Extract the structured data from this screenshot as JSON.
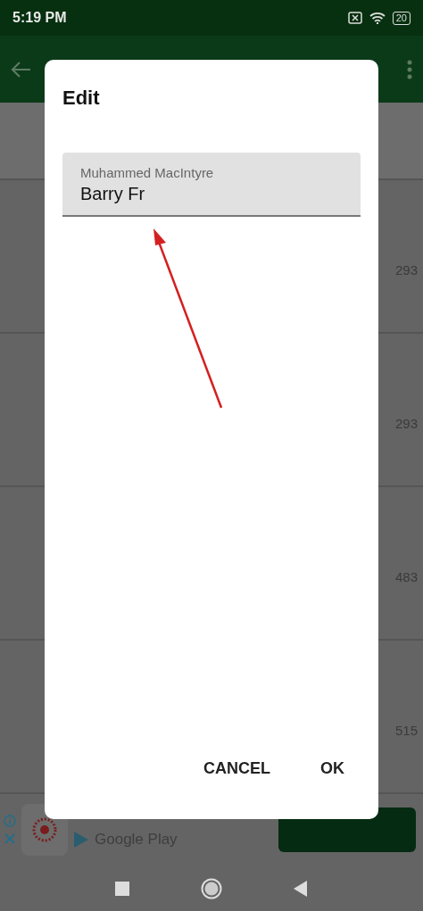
{
  "status_bar": {
    "time": "5:19 PM",
    "battery": "20"
  },
  "list": {
    "rows": [
      {
        "value": "293"
      },
      {
        "value": "293"
      },
      {
        "value": "483"
      },
      {
        "value": "515"
      }
    ]
  },
  "ad_banner": {
    "text": "Google Play"
  },
  "dialog": {
    "title": "Edit",
    "field": {
      "label": "Muhammed MacIntyre",
      "value": "Barry Fr"
    },
    "buttons": [
      "CANCEL",
      "OK"
    ]
  }
}
